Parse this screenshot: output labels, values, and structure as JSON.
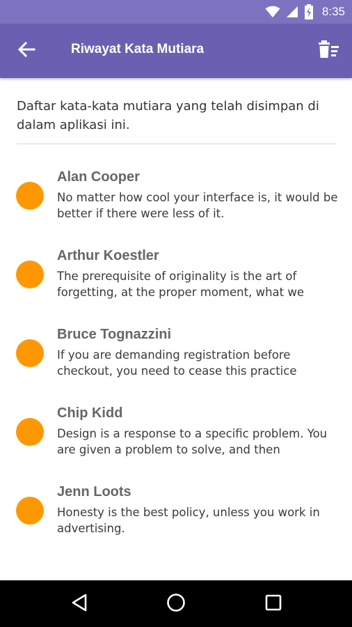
{
  "status_bar": {
    "time": "8:35",
    "icons": [
      "wifi-icon",
      "signal-icon",
      "battery-charging-icon"
    ]
  },
  "app_bar": {
    "title": "Riwayat Kata Mutiara",
    "back_icon": "arrow-back-icon",
    "action_icon": "clear-all-icon"
  },
  "description": "Daftar kata-kata mutiara yang telah disimpan di dalam aplikasi ini.",
  "quotes": [
    {
      "author": "Alan Cooper",
      "text": "No matter how cool your interface is, it would be better if there were less of it."
    },
    {
      "author": "Arthur Koestler",
      "text": "The prerequisite of originality is the art of forgetting, at the proper moment, what we"
    },
    {
      "author": "Bruce Tognazzini",
      "text": "If you are demanding registration before checkout, you need to cease this practice"
    },
    {
      "author": "Chip Kidd",
      "text": "Design is a response to a specific problem. You are given a problem to solve, and then"
    },
    {
      "author": "Jenn Loots",
      "text": "Honesty is the best policy, unless you work in advertising."
    }
  ],
  "colors": {
    "status_bar": "#7b73c0",
    "app_bar": "#6a60b2",
    "dot": "#ff9800",
    "nav_bar": "#000000"
  },
  "nav_bar": {
    "icons": [
      "back-triangle-icon",
      "home-circle-icon",
      "recents-square-icon"
    ]
  }
}
